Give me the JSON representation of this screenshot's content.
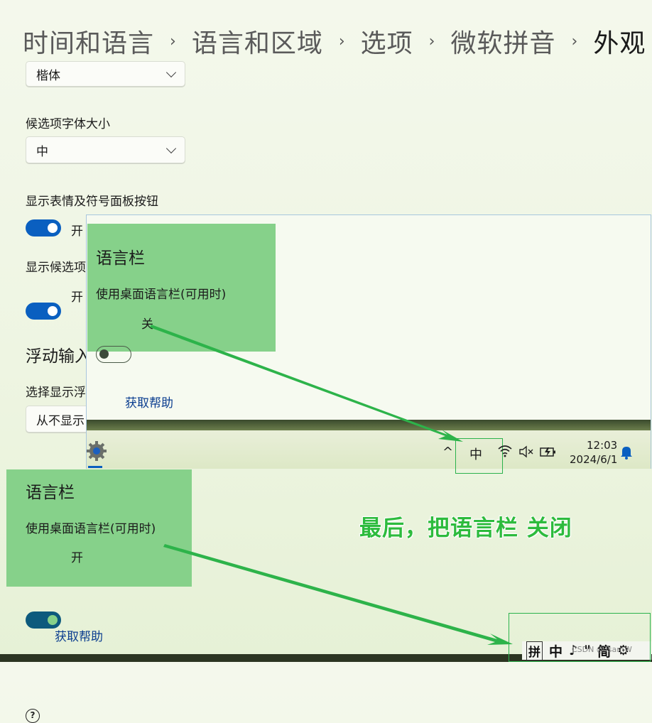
{
  "breadcrumb": {
    "items": [
      "时间和语言",
      "语言和区域",
      "选项",
      "微软拼音",
      "外观"
    ],
    "separator": "›"
  },
  "settings": {
    "font_dropdown_value": "楷体",
    "candidate_font_size_label": "候选项字体大小",
    "candidate_font_size_value": "中",
    "emoji_panel_label": "显示表情及符号面板按钮",
    "emoji_panel_state": "开",
    "candidate_label_partial": "显示候选项",
    "candidate_state": "开",
    "floating_section_partial": "浮动输入",
    "floating_select_label_partial": "选择显示浮",
    "floating_select_value_partial": "从不显示"
  },
  "inset": {
    "language_bar_title": "语言栏",
    "language_bar_option": "使用桌面语言栏(可用时)",
    "language_bar_state": "关",
    "help_link": "获取帮助",
    "taskbar": {
      "chevron": "^",
      "ime_indicator": "中",
      "time": "12:03",
      "date": "2024/6/1"
    }
  },
  "main_language_bar": {
    "title": "语言栏",
    "option": "使用桌面语言栏(可用时)",
    "state": "开"
  },
  "help_link": "获取帮助",
  "annotation": "最后，把语言栏 关闭",
  "ime_toolbar": {
    "items": [
      "拼",
      "中",
      "♪",
      "\"",
      "简",
      "⚙"
    ],
    "watermark": "CSDN @TsamW"
  },
  "colors": {
    "accent_blue": "#0a5fc0",
    "highlight_green": "#86d18a",
    "arrow_green": "#2db34a",
    "link_blue": "#0a3d8f"
  }
}
